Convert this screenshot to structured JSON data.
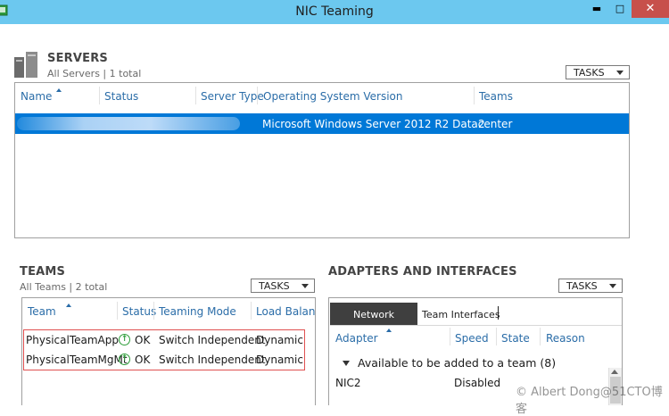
{
  "window": {
    "title": "NIC Teaming",
    "minimize_glyph": "▬",
    "maximize_glyph": "□",
    "close_glyph": "✕",
    "accent_color": "#6cc8ef"
  },
  "servers": {
    "title": "SERVERS",
    "subtitle": "All Servers | 1 total",
    "tasks_label": "TASKS",
    "columns": [
      "Name",
      "Status",
      "Server Type",
      "Operating System Version",
      "Teams"
    ],
    "rows": [
      {
        "name": "",
        "status": "",
        "server_type": "",
        "os_version": "Microsoft Windows Server 2012 R2 Datacenter",
        "teams": "2"
      }
    ]
  },
  "teams": {
    "title": "TEAMS",
    "subtitle": "All Teams | 2 total",
    "tasks_label": "TASKS",
    "columns": [
      "Team",
      "Status",
      "Teaming Mode",
      "Load Balancing"
    ],
    "rows": [
      {
        "team": "PhysicalTeamApp",
        "status": "OK",
        "mode": "Switch Independent",
        "load_balancing": "Dynamic"
      },
      {
        "team": "PhysicalTeamMgMt",
        "status": "OK",
        "mode": "Switch Independent",
        "load_balancing": "Dynamic"
      }
    ],
    "status_icon": "ok-check-icon"
  },
  "adapters": {
    "title": "ADAPTERS AND INTERFACES",
    "tasks_label": "TASKS",
    "tabs": [
      "Network Adapters",
      "Team Interfaces"
    ],
    "columns": [
      "Adapter",
      "Speed",
      "State",
      "Reason"
    ],
    "group_label": "Available to be added to a team (8)",
    "rows": [
      {
        "adapter": "NIC2",
        "speed": "",
        "state": "Disabled",
        "reason": ""
      }
    ]
  },
  "watermark": "© Albert Dong@51CTO博客"
}
